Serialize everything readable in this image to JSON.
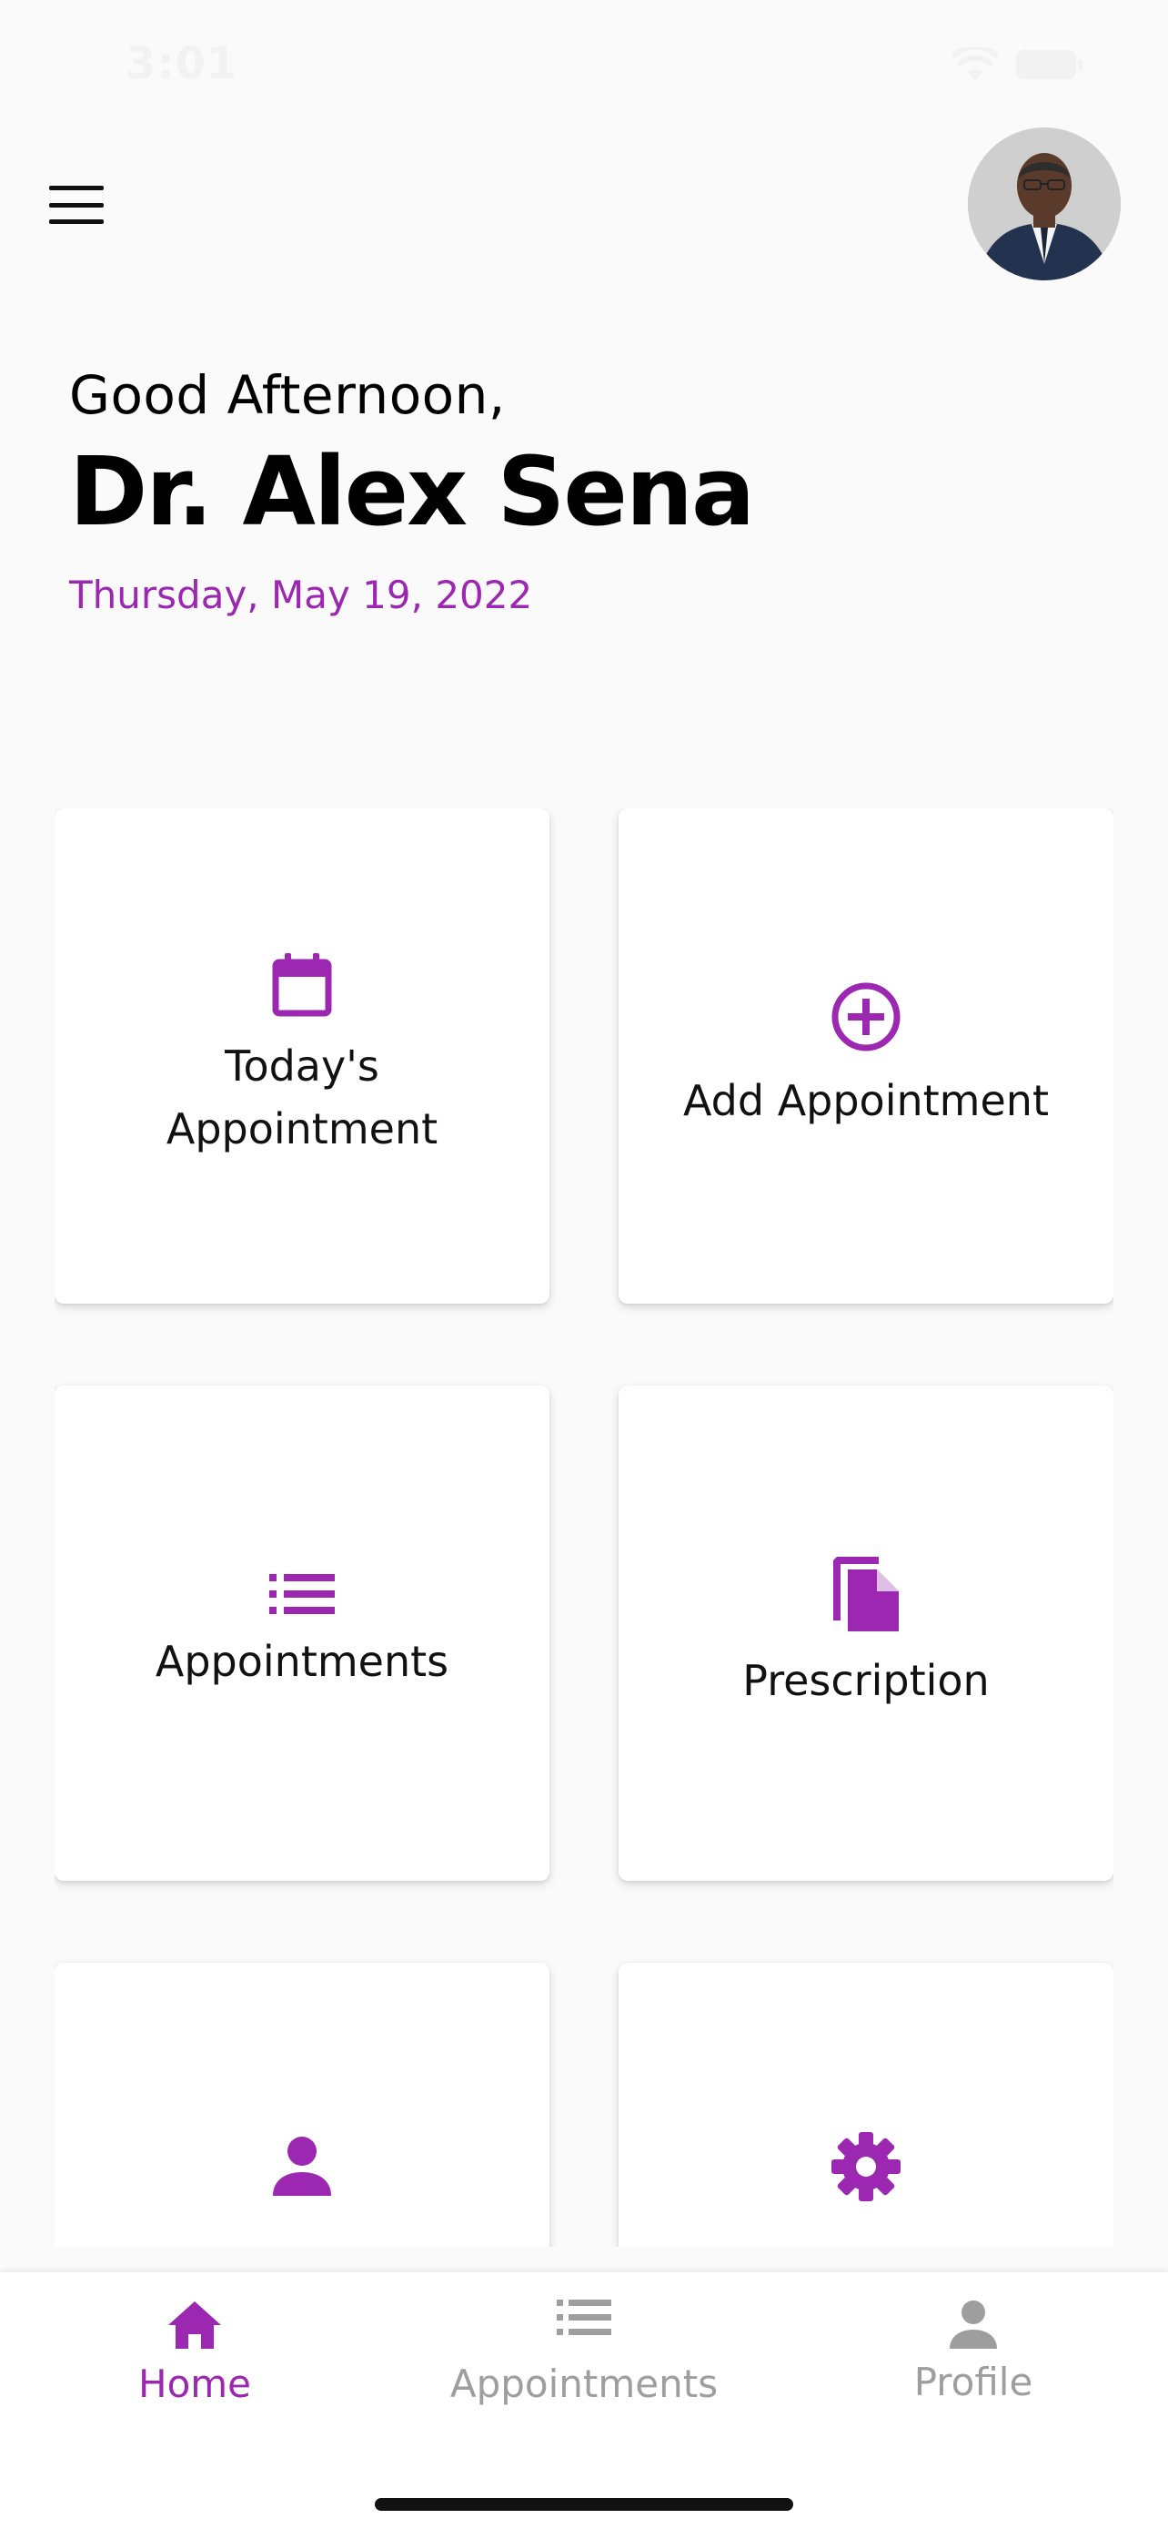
{
  "status_bar": {
    "time": "3:01",
    "icons": [
      "wifi-icon",
      "battery-icon"
    ]
  },
  "header": {
    "menu_icon": "hamburger-menu-icon",
    "avatar_icon": "doctor-avatar"
  },
  "greeting": {
    "salutation": "Good Afternoon,",
    "name": "Dr. Alex Sena",
    "date": "Thursday, May 19, 2022"
  },
  "cards": [
    {
      "label": "Today's Appointment",
      "icon": "calendar-icon"
    },
    {
      "label": "Add Appointment",
      "icon": "add-circle-icon"
    },
    {
      "label": "Appointments",
      "icon": "list-icon"
    },
    {
      "label": "Prescription",
      "icon": "file-copy-icon"
    },
    {
      "label": "",
      "icon": "person-icon"
    },
    {
      "label": "",
      "icon": "settings-icon"
    }
  ],
  "bottom_nav": [
    {
      "label": "Home",
      "icon": "home-icon",
      "active": true
    },
    {
      "label": "Appointments",
      "icon": "list-icon",
      "active": false
    },
    {
      "label": "Profile",
      "icon": "person-icon",
      "active": false
    }
  ],
  "colors": {
    "accent": "#9c27b0",
    "inactive": "#9e9e9e",
    "background": "#fafafa",
    "card": "#ffffff"
  }
}
